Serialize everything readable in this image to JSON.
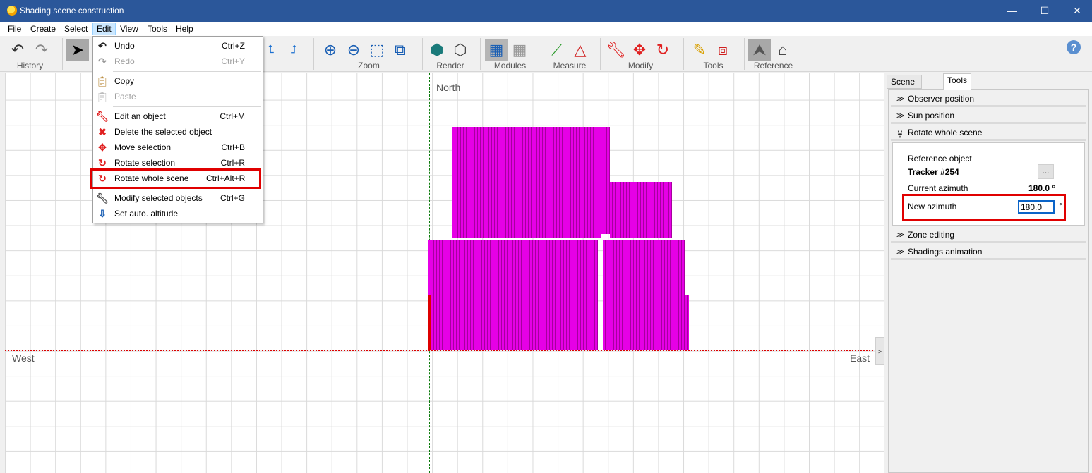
{
  "window": {
    "title": "Shading scene construction",
    "minimize": "—",
    "maximize": "☐",
    "close": "✕"
  },
  "menubar": {
    "items": [
      "File",
      "Create",
      "Select",
      "Edit",
      "View",
      "Tools",
      "Help"
    ],
    "active": "Edit"
  },
  "toolbar": {
    "groups": [
      {
        "label": "History"
      },
      {
        "label": "Zoom"
      },
      {
        "label": "Render"
      },
      {
        "label": "Modules"
      },
      {
        "label": "Measure"
      },
      {
        "label": "Modify"
      },
      {
        "label": "Tools"
      },
      {
        "label": "Reference"
      }
    ],
    "help": "?"
  },
  "edit_menu": {
    "items": [
      {
        "label": "Undo",
        "shortcut": "Ctrl+Z",
        "enabled": true,
        "icon": "undo-icon"
      },
      {
        "label": "Redo",
        "shortcut": "Ctrl+Y",
        "enabled": false,
        "icon": "redo-icon"
      },
      {
        "label": "Copy",
        "shortcut": "",
        "enabled": true,
        "icon": "copy-icon"
      },
      {
        "label": "Paste",
        "shortcut": "",
        "enabled": false,
        "icon": "paste-icon"
      },
      {
        "label": "Edit an object",
        "shortcut": "Ctrl+M",
        "enabled": true,
        "icon": "wrench-icon"
      },
      {
        "label": "Delete the selected object",
        "shortcut": "",
        "enabled": true,
        "icon": "delete-icon"
      },
      {
        "label": "Move selection",
        "shortcut": "Ctrl+B",
        "enabled": true,
        "icon": "move-icon"
      },
      {
        "label": "Rotate selection",
        "shortcut": "Ctrl+R",
        "enabled": true,
        "icon": "rotate-icon"
      },
      {
        "label": "Rotate whole scene",
        "shortcut": "Ctrl+Alt+R",
        "enabled": true,
        "icon": "rotate-scene-icon",
        "highlighted": true
      },
      {
        "label": "Modify selected objects",
        "shortcut": "Ctrl+G",
        "enabled": true,
        "icon": "wrench-icon"
      },
      {
        "label": "Set auto. altitude",
        "shortcut": "",
        "enabled": true,
        "icon": "altitude-icon"
      }
    ]
  },
  "canvas": {
    "north": "North",
    "west": "West",
    "east": "East",
    "collapse": ">"
  },
  "panel": {
    "tabs": [
      "Scene objects",
      "Tools"
    ],
    "active_tab": "Tools",
    "sections": [
      "Observer position",
      "Sun position",
      "Rotate whole scene",
      "Zone editing",
      "Shadings animation"
    ],
    "rotate": {
      "reference_label": "Reference object",
      "reference_value": "Tracker #254",
      "browse": "...",
      "current_label": "Current azimuth",
      "current_value": "180.0 °",
      "new_label": "New azimuth",
      "new_value": "180.0",
      "unit": "°"
    }
  },
  "colors": {
    "accent": "#2b579a",
    "rack": "#e600e6",
    "highlight": "#e00000"
  }
}
